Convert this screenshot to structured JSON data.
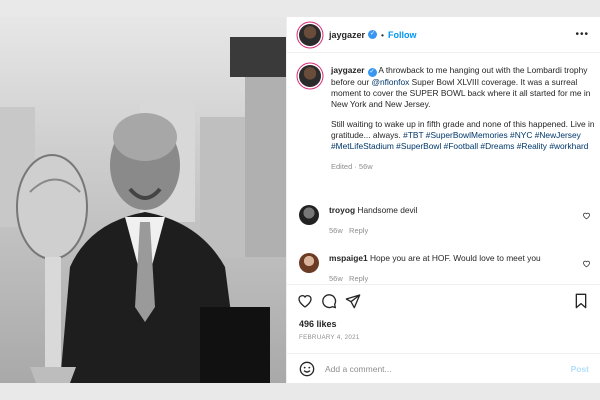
{
  "post": {
    "author": "jaygazer",
    "follow_label": "Follow",
    "more_label": "•••",
    "caption_mention": "@nflonfox",
    "caption_p1_a": " A throwback to me hanging out with the Lombardi trophy before our ",
    "caption_p1_b": " Super Bowl XLVIII coverage. It was a surreal moment to cover the SUPER BOWL back where it all started for me in New York and New Jersey.",
    "caption_p2": "Still waiting to wake up in fifth grade and none of this happened. Live in gratitude... always. ",
    "hashtags": "#TBT #SuperBowlMemories #NYC #NewJersey #MetLifeStadium #SuperBowl #Football #Dreams #Reality #workhard",
    "edited": "Edited · 56w"
  },
  "comments": [
    {
      "user": "troyog",
      "text": " Handsome devil",
      "time": "56w",
      "reply": "Reply"
    },
    {
      "user": "mspaige1",
      "text": " Hope you are at HOF. Would love to meet you",
      "time": "56w",
      "reply": "Reply"
    }
  ],
  "footer": {
    "likes": "496 likes",
    "date": "FEBRUARY 4, 2021",
    "add_placeholder": "Add a comment...",
    "post_label": "Post"
  }
}
